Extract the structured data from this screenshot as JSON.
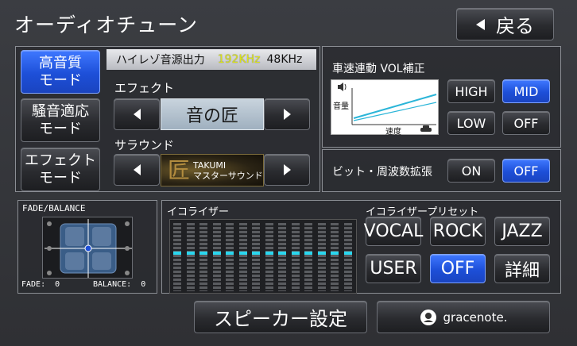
{
  "header": {
    "title": "オーディオチューン",
    "back_label": "戻る"
  },
  "modes": [
    {
      "label_line1": "高音質",
      "label_line2": "モード",
      "active": true
    },
    {
      "label_line1": "騒音適応",
      "label_line2": "モード",
      "active": false
    },
    {
      "label_line1": "エフェクト",
      "label_line2": "モード",
      "active": false
    }
  ],
  "hires": {
    "label": "ハイレゾ音源出力",
    "rate_active": "192KHz",
    "rate_other": "48KHz"
  },
  "effect": {
    "label": "エフェクト",
    "value": "音の匠"
  },
  "surround": {
    "label": "サラウンド",
    "logo_kanji": "匠",
    "line1": "TAKUMI",
    "line2": "マスターサウンド"
  },
  "vol_correction": {
    "label": "車速連動 VOL補正",
    "graph_y_label": "音量",
    "graph_x_label": "速度",
    "options": [
      "HIGH",
      "MID",
      "LOW",
      "OFF"
    ],
    "selected": "MID"
  },
  "bit_expand": {
    "label": "ビット・周波数拡張",
    "options": [
      "ON",
      "OFF"
    ],
    "selected": "OFF"
  },
  "fade_balance": {
    "label": "FADE/BALANCE",
    "fade_label": "FADE:",
    "fade_value": "0",
    "balance_label": "BALANCE:",
    "balance_value": "0"
  },
  "equalizer": {
    "label": "イコライザー",
    "bands": 14,
    "levels": [
      0.56,
      0.56,
      0.56,
      0.56,
      0.56,
      0.56,
      0.56,
      0.56,
      0.56,
      0.56,
      0.56,
      0.56,
      0.56,
      0.56
    ]
  },
  "presets": {
    "label": "イコライザープリセット",
    "items": [
      "VOCAL",
      "ROCK",
      "JAZZ",
      "USER",
      "OFF",
      "詳細"
    ],
    "selected": "OFF"
  },
  "footer": {
    "speaker_label": "スピーカー設定",
    "gracenote_label": "gracenote."
  },
  "colors": {
    "accent_blue": "#1d4fd8",
    "hires_yellow": "#d9e21a",
    "eq_level": "#2ad7ef"
  }
}
